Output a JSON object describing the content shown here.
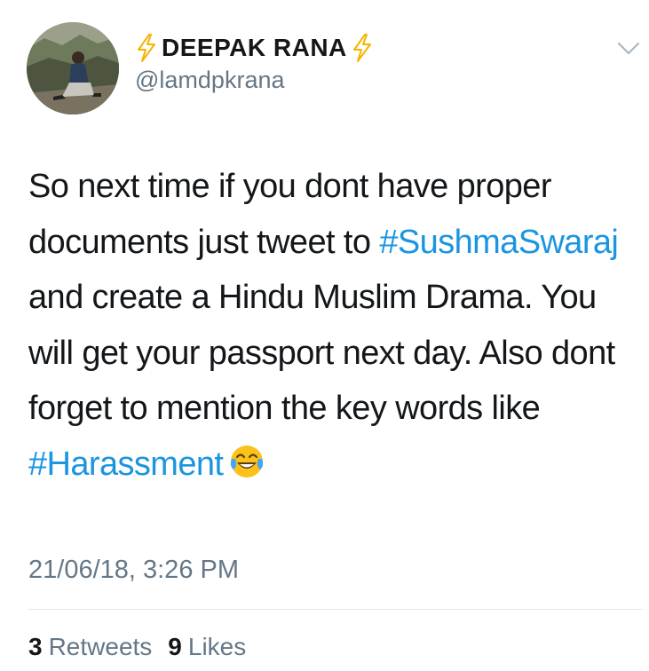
{
  "author": {
    "name": "DEEPAK RANA",
    "handle": "@lamdpkrana",
    "name_emoji": "high-voltage-icon"
  },
  "tweet": {
    "segments": [
      {
        "text": "So next time if you dont have proper documents just tweet to ",
        "type": "text"
      },
      {
        "text": "#SushmaSwaraj",
        "type": "hashtag"
      },
      {
        "text": " and create a Hindu Muslim Drama. You will get your passport next day. Also dont forget to mention the key words like ",
        "type": "text"
      },
      {
        "text": "#Harassment",
        "type": "hashtag"
      }
    ],
    "trailing_emoji": "face-with-tears-of-joy-icon",
    "timestamp": "21/06/18, 3:26 PM"
  },
  "stats": {
    "retweets_count": "3",
    "retweets_label": "Retweets",
    "likes_count": "9",
    "likes_label": "Likes"
  },
  "colors": {
    "hashtag": "#1b95e0",
    "secondary_text": "#657786",
    "primary_text": "#14171a",
    "divider": "#e1e8ed",
    "bolt": "#f4b400"
  }
}
